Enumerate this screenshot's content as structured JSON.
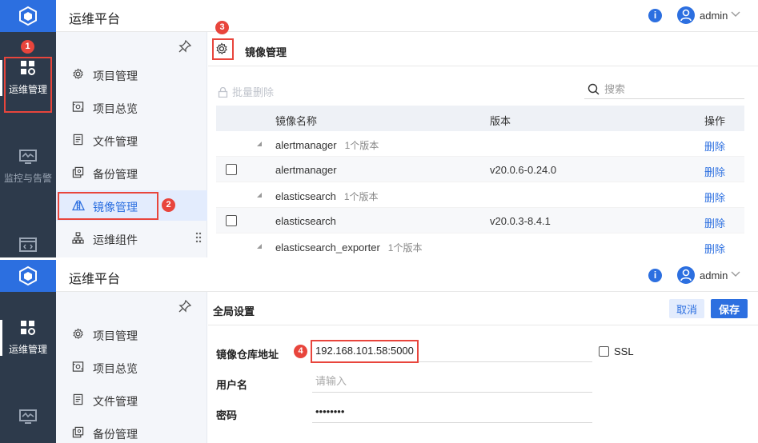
{
  "app": {
    "title": "运维平台",
    "user": "admin",
    "info_glyph": "i",
    "accent": "#2c6fe0",
    "rail_bg": "#2d3a4b",
    "annotation": "#e8453c"
  },
  "rail": [
    {
      "label": "运维管理",
      "icon": "ops-grid-icon",
      "active": true
    },
    {
      "label": "监控与告警",
      "icon": "monitor-icon",
      "active": false
    },
    {
      "label": "",
      "icon": "code-window-icon",
      "active": false
    }
  ],
  "submenu": [
    {
      "label": "项目管理",
      "icon": "gear-icon"
    },
    {
      "label": "项目总览",
      "icon": "overview-icon"
    },
    {
      "label": "文件管理",
      "icon": "file-icon"
    },
    {
      "label": "备份管理",
      "icon": "backup-icon"
    },
    {
      "label": "镜像管理",
      "icon": "mirror-icon",
      "active": true
    },
    {
      "label": "运维组件",
      "icon": "components-icon"
    }
  ],
  "image_page": {
    "tab_title": "镜像管理",
    "batch_delete": "批量删除",
    "search_placeholder": "搜索",
    "columns": {
      "name": "镜像名称",
      "version": "版本",
      "action": "操作"
    },
    "rows": [
      {
        "type": "group",
        "name": "alertmanager",
        "count": "1个版本",
        "action": "删除"
      },
      {
        "type": "item",
        "name": "alertmanager",
        "version": "v20.0.6-0.24.0",
        "action": "删除"
      },
      {
        "type": "group",
        "name": "elasticsearch",
        "count": "1个版本",
        "action": "删除"
      },
      {
        "type": "item",
        "name": "elasticsearch",
        "version": "v20.0.3-8.4.1",
        "action": "删除"
      },
      {
        "type": "group",
        "name": "elasticsearch_exporter",
        "count": "1个版本",
        "action": "删除"
      }
    ]
  },
  "settings_page": {
    "title": "全局设置",
    "cancel": "取消",
    "save": "保存",
    "registry_label": "镜像仓库地址",
    "registry_value": "192.168.101.58:5000",
    "ssl_label": "SSL",
    "username_label": "用户名",
    "username_placeholder": "请输入",
    "password_label": "密码",
    "password_value": "abcdefgh"
  },
  "annotations": [
    "1",
    "2",
    "3",
    "4"
  ]
}
